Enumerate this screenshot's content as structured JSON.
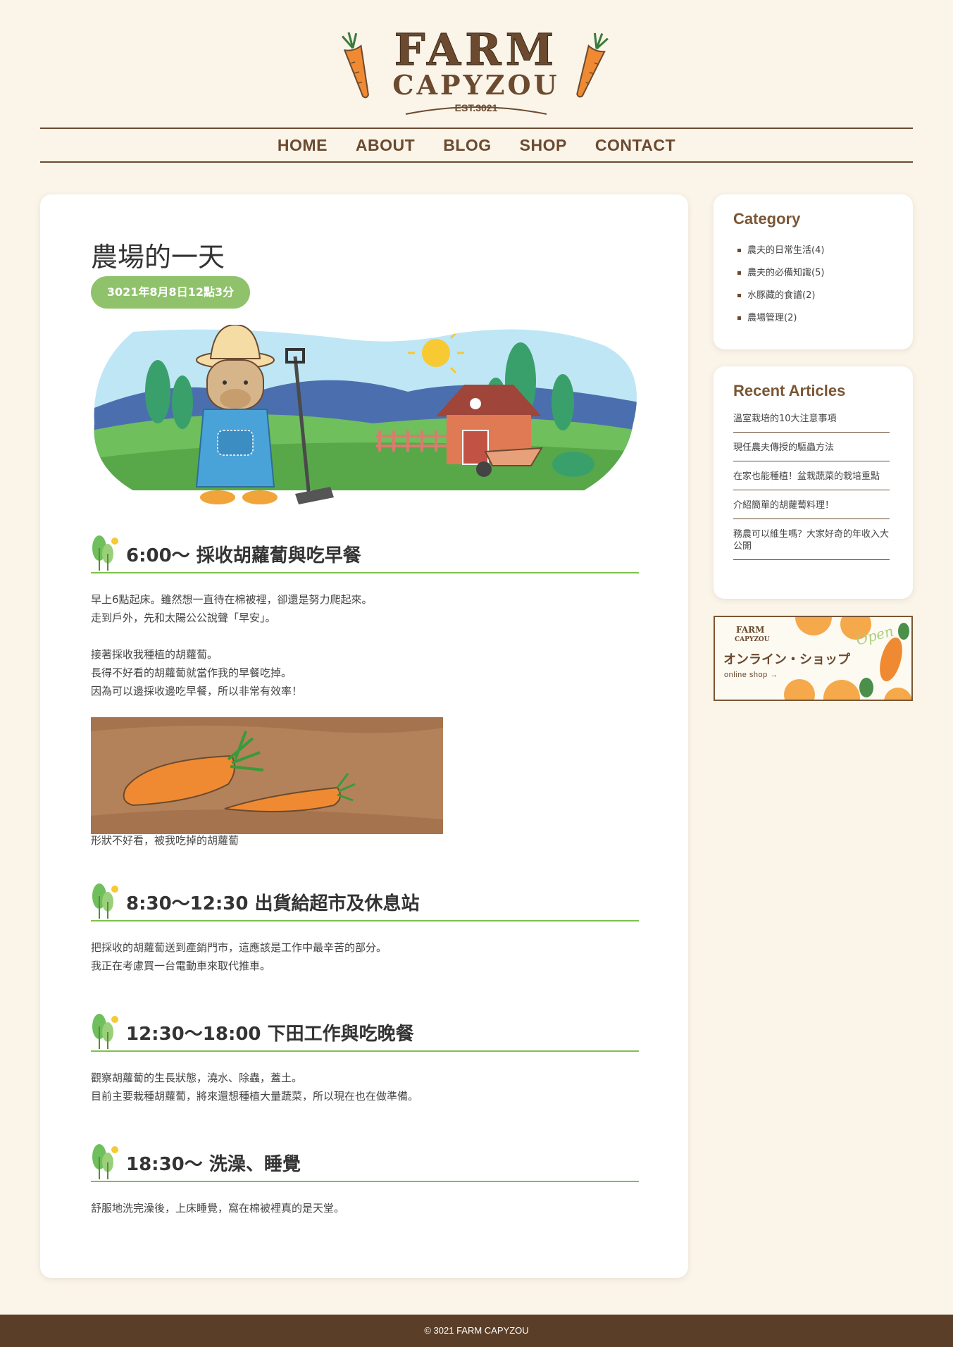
{
  "logo": {
    "line1": "FARM",
    "line2": "CAPYZOU",
    "est": "EST.3021"
  },
  "nav": [
    "HOME",
    "ABOUT",
    "BLOG",
    "SHOP",
    "CONTACT"
  ],
  "post": {
    "title": "農場的一天",
    "date": "3021年8月8日12點3分",
    "sections": [
      {
        "heading": "6:00〜 採收胡蘿蔔與吃早餐",
        "lines": [
          "早上6點起床。雖然想一直待在棉被裡，卻還是努力爬起來。",
          "走到戶外，先和太陽公公說聲「早安」。",
          "",
          "接著採收我種植的胡蘿蔔。",
          "長得不好看的胡蘿蔔就當作我的早餐吃掉。",
          "因為可以邊採收邊吃早餐，所以非常有效率！"
        ],
        "caption": "形狀不好看，被我吃掉的胡蘿蔔"
      },
      {
        "heading": "8:30〜12:30 出貨給超市及休息站",
        "lines": [
          "把採收的胡蘿蔔送到產銷門市，這應該是工作中最辛苦的部分。",
          "我正在考慮買一台電動車來取代推車。"
        ]
      },
      {
        "heading": "12:30〜18:00 下田工作與吃晚餐",
        "lines": [
          "觀察胡蘿蔔的生長狀態，澆水、除蟲，蓋土。",
          "目前主要栽種胡蘿蔔，將來還想種植大量蔬菜，所以現在也在做準備。"
        ]
      },
      {
        "heading": "18:30〜 洗澡、睡覺",
        "lines": [
          "舒服地洗完澡後，上床睡覺，窩在棉被裡真的是天堂。"
        ]
      }
    ]
  },
  "sidebar": {
    "category": {
      "title": "Category",
      "items": [
        "農夫的日常生活(4)",
        "農夫的必備知識(5)",
        "水豚藏的食譜(2)",
        "農場管理(2)"
      ]
    },
    "recent": {
      "title": "Recent Articles",
      "items": [
        "溫室栽培的10大注意事項",
        "現任農夫傳授的驅蟲方法",
        "在家也能種植！盆栽蔬菜的栽培重點",
        "介紹簡單的胡蘿蔔料理！",
        "務農可以維生嗎？大家好奇的年收入大公開"
      ]
    },
    "shop_banner": {
      "logo_line1": "FARM",
      "logo_line2": "CAPYZOU",
      "title_jp": "オンライン・ショップ",
      "subtitle": "online shop →",
      "open_text": "Open"
    }
  },
  "footer": {
    "copyright": "© 3021 FARM CAPYZOU"
  },
  "colors": {
    "background": "#faf4e9",
    "brown": "#6b4a2f",
    "accent_green": "#8fc26b",
    "underline_green": "#7bc24a",
    "carrot": "#f08a32",
    "footer": "#5a3e27"
  }
}
